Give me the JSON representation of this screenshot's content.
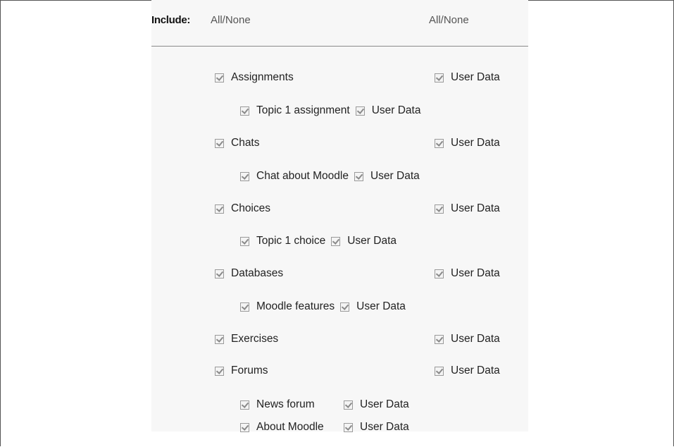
{
  "include": {
    "label": "Include:",
    "all_none_left": "All/None",
    "all_none_right": "All/None"
  },
  "modules": [
    {
      "label": "Assignments",
      "user_data_label": "User Data",
      "checked": true,
      "children": [
        {
          "label": "Topic 1 assignment",
          "user_data_label": "User Data",
          "checked": true
        }
      ]
    },
    {
      "label": "Chats",
      "user_data_label": "User Data",
      "checked": true,
      "children": [
        {
          "label": "Chat about Moodle",
          "user_data_label": "User Data",
          "checked": true
        }
      ]
    },
    {
      "label": "Choices",
      "user_data_label": "User Data",
      "checked": true,
      "children": [
        {
          "label": "Topic 1 choice",
          "user_data_label": "User Data",
          "checked": true
        }
      ]
    },
    {
      "label": "Databases",
      "user_data_label": "User Data",
      "checked": true,
      "children": [
        {
          "label": "Moodle features",
          "user_data_label": "User Data",
          "checked": true
        }
      ]
    },
    {
      "label": "Exercises",
      "user_data_label": "User Data",
      "checked": true,
      "children": []
    },
    {
      "label": "Forums",
      "user_data_label": "User Data",
      "checked": true,
      "children": [
        {
          "label": "News forum",
          "user_data_label": "User Data",
          "checked": true
        },
        {
          "label": "About Moodle",
          "user_data_label": "User Data",
          "checked": true
        }
      ]
    }
  ]
}
